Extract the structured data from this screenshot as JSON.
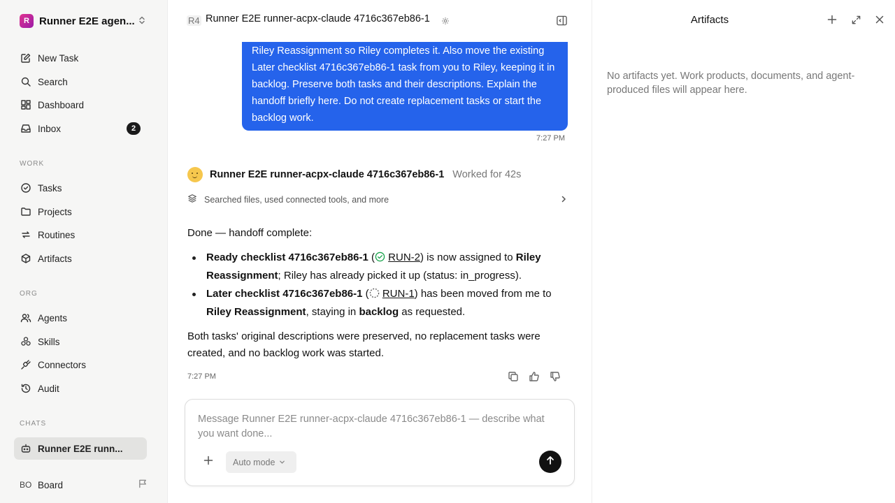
{
  "workspace": {
    "logo_letter": "R",
    "name": "Runner E2E agen..."
  },
  "nav": {
    "top": [
      {
        "label": "New Task",
        "icon": "edit-icon"
      },
      {
        "label": "Search",
        "icon": "search-icon"
      },
      {
        "label": "Dashboard",
        "icon": "dashboard-icon"
      },
      {
        "label": "Inbox",
        "icon": "inbox-icon",
        "badge": "2"
      }
    ],
    "work_label": "WORK",
    "work": [
      {
        "label": "Tasks",
        "icon": "check-circle-icon"
      },
      {
        "label": "Projects",
        "icon": "folder-icon"
      },
      {
        "label": "Routines",
        "icon": "repeat-icon"
      },
      {
        "label": "Artifacts",
        "icon": "box-icon"
      }
    ],
    "org_label": "ORG",
    "org": [
      {
        "label": "Agents",
        "icon": "users-icon"
      },
      {
        "label": "Skills",
        "icon": "skills-icon"
      },
      {
        "label": "Connectors",
        "icon": "plug-icon"
      },
      {
        "label": "Audit",
        "icon": "history-icon"
      }
    ],
    "chats_label": "CHATS",
    "chats": [
      {
        "label": "Runner E2E runn...",
        "icon": "bot-icon"
      }
    ]
  },
  "board": {
    "initials": "BO",
    "label": "Board"
  },
  "header": {
    "code": "R4",
    "title": "Runner E2E runner-acpx-claude 4716c367eb86-1"
  },
  "user_message": {
    "text": "Riley Reassignment so Riley completes it. Also move the existing Later checklist 4716c367eb86-1 task from you to Riley, keeping it in backlog. Preserve both tasks and their descriptions. Explain the handoff briefly here. Do not create replacement tasks or start the backlog work.",
    "time": "7:27 PM"
  },
  "agent": {
    "name": "Runner E2E runner-acpx-claude 4716c367eb86-1",
    "worked": "Worked for 42s",
    "tools_summary": "Searched files, used connected tools, and more",
    "intro": "Done — handoff complete:",
    "bullet1": {
      "title": "Ready checklist 4716c367eb86-1",
      "open": " (",
      "link": "RUN-2",
      "mid": ") is now assigned to ",
      "assignee": "Riley Reassignment",
      "rest": "; Riley has already picked it up (status: in_progress)."
    },
    "bullet2": {
      "title": "Later checklist 4716c367eb86-1",
      "open": " (",
      "link": "RUN-1",
      "mid": ") has been moved from me to ",
      "assignee": "Riley Reassignment",
      "mid2": ", staying in ",
      "state": "backlog",
      "rest": " as requested."
    },
    "closing": "Both tasks' original descriptions were preserved, no replacement tasks were created, and no backlog work was started.",
    "time": "7:27 PM"
  },
  "composer": {
    "placeholder": "Message Runner E2E runner-acpx-claude 4716c367eb86-1 — describe what you want done...",
    "mode": "Auto mode"
  },
  "artifacts": {
    "title": "Artifacts",
    "empty": "No artifacts yet. Work products, documents, and agent-produced files will appear here."
  },
  "colors": {
    "accent": "#2563eb",
    "done_status": "#16a34a"
  }
}
